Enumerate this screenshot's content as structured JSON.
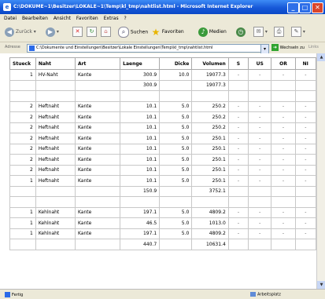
{
  "window": {
    "title": "C:\\DOKUME~1\\Besitzer\\LOKALE~1\\Temp\\kl_tmp\\nahtlist.html - Microsoft Internet Explorer",
    "minimize": "_",
    "maximize": "□",
    "close": "✕"
  },
  "menu": [
    "Datei",
    "Bearbeiten",
    "Ansicht",
    "Favoriten",
    "Extras",
    "?"
  ],
  "toolbar": {
    "back_label": "Zurück",
    "search_label": "Suchen",
    "favorites_label": "Favoriten",
    "media_label": "Medien"
  },
  "address": {
    "label": "Adresse",
    "value": "C:\\Dokumente und Einstellungen\\Besitzer\\Lokale Einstellungen\\Temp\\kl_tmp\\nahtlist.html",
    "go_label": "Wechseln zu",
    "links_label": "Links"
  },
  "table": {
    "headers": [
      "Stueck",
      "Naht",
      "Art",
      "Laenge",
      "Dicke",
      "Volumen",
      "S",
      "US",
      "OR",
      "NI"
    ],
    "rows": [
      [
        "1",
        "HV-Naht",
        "Kante",
        "300.9",
        "10.0",
        "19077.3",
        "-",
        "-",
        "-",
        "-"
      ],
      [
        "",
        "",
        "",
        "300.9",
        "",
        "19077.3",
        "",
        "",
        "",
        ""
      ],
      [
        "",
        "",
        "",
        "",
        "",
        "",
        "",
        "",
        "",
        ""
      ],
      [
        "2",
        "Heftnaht",
        "Kante",
        "10.1",
        "5.0",
        "250.2",
        "-",
        "-",
        "-",
        "-"
      ],
      [
        "2",
        "Heftnaht",
        "Kante",
        "10.1",
        "5.0",
        "250.2",
        "-",
        "-",
        "-",
        "-"
      ],
      [
        "2",
        "Heftnaht",
        "Kante",
        "10.1",
        "5.0",
        "250.2",
        "-",
        "-",
        "-",
        "-"
      ],
      [
        "2",
        "Heftnaht",
        "Kante",
        "10.1",
        "5.0",
        "250.1",
        "-",
        "-",
        "-",
        "-"
      ],
      [
        "2",
        "Heftnaht",
        "Kante",
        "10.1",
        "5.0",
        "250.1",
        "-",
        "-",
        "-",
        "-"
      ],
      [
        "2",
        "Heftnaht",
        "Kante",
        "10.1",
        "5.0",
        "250.1",
        "-",
        "-",
        "-",
        "-"
      ],
      [
        "2",
        "Heftnaht",
        "Kante",
        "10.1",
        "5.0",
        "250.1",
        "-",
        "-",
        "-",
        "-"
      ],
      [
        "1",
        "Heftnaht",
        "Kante",
        "10.1",
        "5.0",
        "250.1",
        "-",
        "-",
        "-",
        "-"
      ],
      [
        "",
        "",
        "",
        "150.9",
        "",
        "3752.1",
        "",
        "",
        "",
        ""
      ],
      [
        "",
        "",
        "",
        "",
        "",
        "",
        "",
        "",
        "",
        ""
      ],
      [
        "1",
        "Kehlnaht",
        "Kante",
        "197.1",
        "5.0",
        "4809.2",
        "-",
        "-",
        "-",
        "-"
      ],
      [
        "1",
        "Kehlnaht",
        "Kante",
        "46.5",
        "5.0",
        "1013.0",
        "-",
        "-",
        "-",
        "-"
      ],
      [
        "1",
        "Kehlnaht",
        "Kante",
        "197.1",
        "5.0",
        "4809.2",
        "-",
        "-",
        "-",
        "-"
      ],
      [
        "",
        "",
        "",
        "440.7",
        "",
        "10631.4",
        "",
        "",
        "",
        ""
      ]
    ]
  },
  "status": {
    "left": "Fertig",
    "right": "Arbeitsplatz"
  },
  "colors": {
    "titlebar": "#0A48C6",
    "chrome": "#ECE9D8"
  }
}
